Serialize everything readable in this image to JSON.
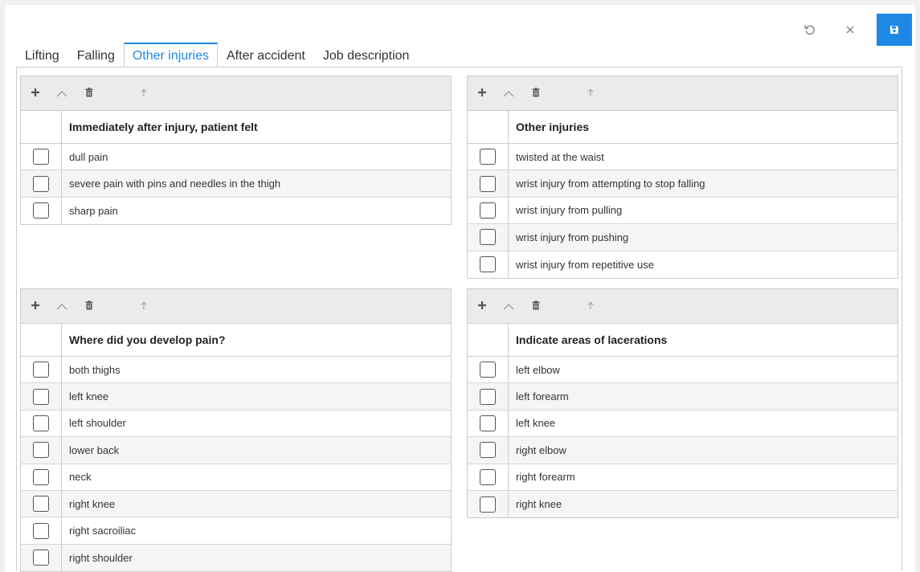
{
  "toolbar": {
    "undo_icon": "undo-icon",
    "close_icon": "close-icon",
    "save_icon": "save-icon",
    "save_color": "#1e88e5"
  },
  "tabs": [
    {
      "label": "Lifting",
      "active": false
    },
    {
      "label": "Falling",
      "active": false
    },
    {
      "label": "Other injuries",
      "active": true
    },
    {
      "label": "After accident",
      "active": false
    },
    {
      "label": "Job description",
      "active": false
    }
  ],
  "grids": [
    {
      "header": "Immediately after injury, patient felt",
      "rows": [
        "dull pain",
        "severe pain with pins and needles in the thigh",
        "sharp pain"
      ]
    },
    {
      "header": "Other injuries",
      "rows": [
        "twisted at the waist",
        "wrist injury from attempting to stop falling",
        "wrist injury from pulling",
        "wrist injury from pushing",
        "wrist injury from repetitive use"
      ]
    },
    {
      "header": "Where did you develop pain?",
      "rows": [
        "both thighs",
        "left knee",
        "left shoulder",
        "lower back",
        "neck",
        "right knee",
        "right sacroiliac",
        "right shoulder"
      ]
    },
    {
      "header": "Indicate areas of lacerations",
      "rows": [
        "left elbow",
        "left forearm",
        "left knee",
        "right elbow",
        "right forearm",
        "right knee"
      ]
    }
  ],
  "grid_toolbar_icons": [
    "plus-icon",
    "chevron-up-icon",
    "trash-icon",
    "arrow-up-icon"
  ]
}
